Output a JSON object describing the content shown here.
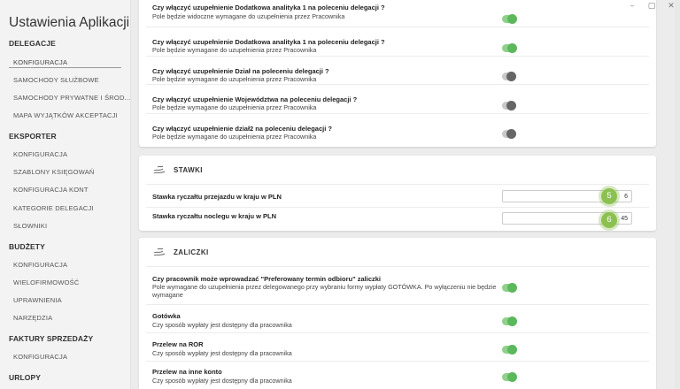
{
  "window": {
    "controls": [
      "–",
      "▢",
      "✕"
    ]
  },
  "sidebar": {
    "title": "Ustawienia Aplikacji",
    "sections": [
      {
        "title": "DELEGACJE",
        "items": [
          "KONFIGURACJA",
          "SAMOCHODY SŁUŻBOWE",
          "SAMOCHODY PRYWATNE I ŚROD...",
          "MAPA WYJĄTKÓW AKCEPTACJI"
        ]
      },
      {
        "title": "EKSPORTER",
        "items": [
          "KONFIGURACJA",
          "SZABLONY KSIĘGOWAŃ",
          "KONFIGURACJA KONT",
          "KATEGORIE DELEGACJI",
          "SŁOWNIKI"
        ]
      },
      {
        "title": "BUDŻETY",
        "items": [
          "KONFIGURACJA",
          "WIELOFIRMOWOŚĆ",
          "UPRAWNIENIA",
          "NARZĘDZIA"
        ]
      },
      {
        "title": "FAKTURY SPRZEDAŻY",
        "items": [
          "KONFIGURACJA"
        ]
      },
      {
        "title": "URLOPY",
        "items": []
      }
    ]
  },
  "top_card": {
    "rows": [
      {
        "title": "Czy włączyć uzupełnienie Dodatkowa analityka 1 na poleceniu delegacji ?",
        "desc": "Pole będzie widoczne wymagane do uzupełnienia przez Pracownika",
        "toggle": "on"
      },
      {
        "title": "Czy włączyć uzupełnienie Dodatkowa analityka 1 na poleceniu delegacji ?",
        "desc": "Pole będzie wymagane do uzupełnienia przez Pracownika",
        "toggle": "on"
      },
      {
        "title": "Czy włączyć uzupełnienie Dział na poleceniu delegacji ?",
        "desc": "Pole będzie wymagane do uzupełnienia przez Pracownika",
        "toggle": "off"
      },
      {
        "title": "Czy włączyć uzupełnienie Województwa na poleceniu delegacji ?",
        "desc": "Pole będzie wymagane do uzupełnienia przez Pracownika",
        "toggle": "off"
      },
      {
        "title": "Czy włączyć uzupełnienie dział2 na poleceniu delegacji ?",
        "desc": "Pole będzie wymagane do uzupełnienia przez Pracownika",
        "toggle": "off"
      }
    ]
  },
  "stawki": {
    "header": "STAWKI",
    "rows": [
      {
        "label": "Stawka ryczałtu przejazdu w kraju w PLN",
        "value": "6",
        "badge": "5"
      },
      {
        "label": "Stawka ryczałtu noclegu w kraju w PLN",
        "value": "45",
        "badge": "6"
      }
    ]
  },
  "zaliczki": {
    "header": "ZALICZKI",
    "rows": [
      {
        "title": "Czy pracownik może wprowadzać \"Preferowany termin odbioru\" zaliczki",
        "desc": "Pole wymagane do uzupełnienia przez delegowanego przy wybraniu formy wypłaty GOTÓWKA. Po wyłączeniu nie będzie wymagane",
        "toggle": "on"
      },
      {
        "title": "Gotówka",
        "desc": "Czy sposób wypłaty jest dostępny dla pracownika",
        "toggle": "on"
      },
      {
        "title": "Przelew na ROR",
        "desc": "Czy sposób wypłaty jest dostępny dla pracownika",
        "toggle": "on"
      },
      {
        "title": "Przelew na inne konto",
        "desc": "Czy sposób wypłaty jest dostępny dla pracownika",
        "toggle": "on"
      }
    ]
  },
  "colors": {
    "accent_green": "#5cb85c",
    "badge_green": "#8cc152",
    "toggle_off": "#666666"
  },
  "icons": {
    "stawki": "hand-coins-icon",
    "zaliczki": "hand-coins-icon"
  }
}
